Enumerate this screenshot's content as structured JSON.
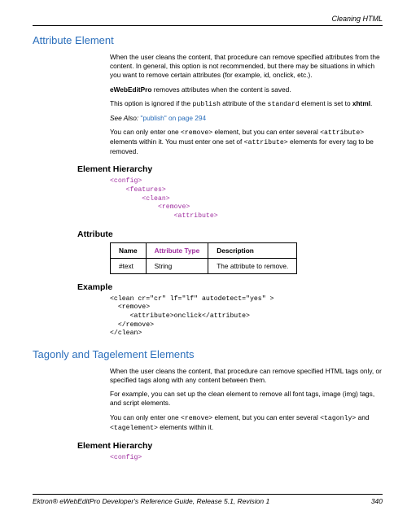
{
  "running_head": "Cleaning HTML",
  "section1": {
    "title": "Attribute Element",
    "para1": "When the user cleans the content, that procedure can remove specified attributes from the content. In general, this option is not recommended, but there may be situations in which you want to remove certain attributes (for example, id, onclick, etc.).",
    "para2_a": "eWebEditPro",
    "para2_b": " removes attributes when the content is saved.",
    "para3_a": "This option is ignored if the ",
    "para3_b": "publish",
    "para3_c": " attribute of the ",
    "para3_d": "standard",
    "para3_e": " element is set to ",
    "para3_f": "xhtml",
    "para3_g": ".",
    "seealso_a": "See Also: ",
    "seealso_b": "\"publish\" on page 294",
    "para4_a": "You can only enter one ",
    "para4_b": "<remove>",
    "para4_c": " element, but you can enter several ",
    "para4_d": "<attribute>",
    "para4_e": " elements within it. You must enter one set of ",
    "para4_f": "<attribute>",
    "para4_g": " elements for every tag to be removed."
  },
  "hierarchy_heading": "Element Hierarchy",
  "hierarchy1": "<config>\n    <features>\n        <clean>\n            <remove>\n                <attribute>",
  "attribute_heading": "Attribute",
  "table": {
    "h1": "Name",
    "h2": "Attribute Type",
    "h3": "Description",
    "c1": "#text",
    "c2": "String",
    "c3": "The attribute to remove."
  },
  "example_heading": "Example",
  "example_code": "<clean cr=\"cr\" lf=\"lf\" autodetect=\"yes\" >\n  <remove>\n     <attribute>onclick</attribute>\n  </remove>\n</clean>",
  "section2": {
    "title": "Tagonly and Tagelement Elements",
    "para1": "When the user cleans the content, that procedure can remove specified HTML tags only, or specified tags along with any content between them.",
    "para2": "For example, you can set up the clean element to remove all font tags, image (img) tags, and script elements.",
    "para3_a": "You can only enter one ",
    "para3_b": "<remove>",
    "para3_c": " element, but you can enter several ",
    "para3_d": "<tagonly>",
    "para3_e": " and ",
    "para3_f": "<tagelement>",
    "para3_g": " elements within it."
  },
  "hierarchy2": "<config>",
  "footer_left": "Ektron® eWebEditPro Developer's Reference Guide, Release 5.1, Revision 1",
  "footer_right": "340"
}
